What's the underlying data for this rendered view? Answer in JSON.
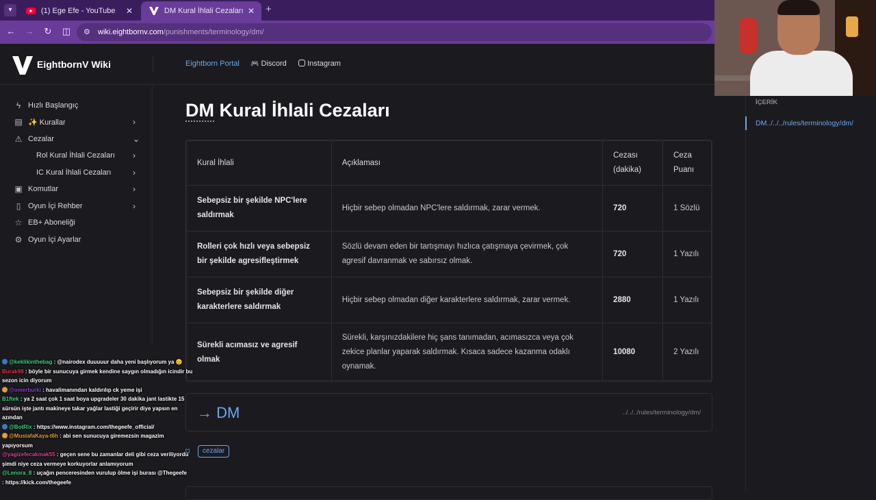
{
  "browser": {
    "tabs": [
      {
        "title": "(1) Ege Efe - YouTube",
        "favicon": "youtube-icon",
        "active": false
      },
      {
        "title": "DM Kural İhlali Cezaları",
        "favicon": "eightborn-v-icon",
        "active": true
      }
    ],
    "new_tab_label": "+",
    "url_host": "wiki.eightbornv.com",
    "url_path": "/punishments/terminology/dm/"
  },
  "header": {
    "site_title": "EightbornV Wiki",
    "links": [
      "Eightborn Portal",
      "Discord",
      "Instagram"
    ]
  },
  "sidebar": {
    "items": [
      {
        "label": "Hızlı Başlangıç",
        "icon": "bolt-icon",
        "chevron": ""
      },
      {
        "label": "✨ Kurallar",
        "icon": "book-icon",
        "chevron": "›"
      },
      {
        "label": "Cezalar",
        "icon": "warning-icon",
        "chevron": "⌄"
      },
      {
        "label": "Rol Kural İhlali Cezaları",
        "icon": "",
        "chevron": "›"
      },
      {
        "label": "IC Kural İhlali Cezaları",
        "icon": "",
        "chevron": "›"
      },
      {
        "label": "Komutlar",
        "icon": "terminal-icon",
        "chevron": "›"
      },
      {
        "label": "Oyun İçi Rehber",
        "icon": "phone-icon",
        "chevron": "›"
      },
      {
        "label": "EB+ Aboneliği",
        "icon": "star-icon",
        "chevron": ""
      },
      {
        "label": "Oyun İçi Ayarlar",
        "icon": "gear-icon",
        "chevron": ""
      }
    ]
  },
  "main": {
    "title_abbr": "DM",
    "title_rest": " Kural İhlali Cezaları",
    "table": {
      "headers": [
        "Kural İhlali",
        "Açıklaması",
        "Cezası (dakika)",
        "Ceza Puanı"
      ],
      "rows": [
        [
          "Sebepsiz bir şekilde NPC'lere saldırmak",
          "Hiçbir sebep olmadan NPC'lere saldırmak, zarar vermek.",
          "720",
          "1 Sözlü"
        ],
        [
          "Rolleri çok hızlı veya sebepsiz bir şekilde agresifleştirmek",
          "Sözlü devam eden bir tartışmayı hızlıca çatışmaya çevirmek, çok agresif davranmak ve sabırsız olmak.",
          "720",
          "1 Yazılı"
        ],
        [
          "Sebepsiz bir şekilde diğer karakterlere saldırmak",
          "Hiçbir sebep olmadan diğer karakterlere saldırmak, zarar vermek.",
          "2880",
          "1 Yazılı"
        ],
        [
          "Sürekli acımasız ve agresif olmak",
          "Sürekli, karşınızdakilere hiç şans tanımadan, acımasızca veya çok zekice planlar yaparak saldırmak. Kısaca sadece kazanma odaklı oynamak.",
          "10080",
          "2 Yazılı"
        ]
      ]
    },
    "dm_card": {
      "arrow": "→",
      "title": "DM",
      "path": "../../../rules/terminology/dm/"
    },
    "tag": "cezalar"
  },
  "toc": {
    "header": "İÇERİK",
    "items": [
      "DM../../../rules/terminology/dm/"
    ]
  },
  "chat": [
    {
      "user": "@keklikinthebag",
      "user_color": "#3fd27a",
      "msg": ": @nairodex duuuuur daha yeni başlıyorum ya 😊"
    },
    {
      "user": "Burak98",
      "user_color": "#e0344a",
      "msg": ": böyle bir sunucuya girmek kendine saygın olmadığın icindir bu sezon icin diyorum"
    },
    {
      "user": "@omerburki",
      "user_color": "#8a3fd6",
      "msg": ": havalimanından kaldırılıp ck yeme işi"
    },
    {
      "user": "B1ftek",
      "user_color": "#3fd27a",
      "msg": ": ya 2 saat çok 1 saat boya upgradeler 30 dakika jant lastikte 15 sürsün işte jantı makineye takar yağlar lastiği geçirir diye yapsın en azından"
    },
    {
      "user": "@BotRix",
      "user_color": "#3fd27a",
      "msg": ": https://www.instagram.com/thegeefe_official/"
    },
    {
      "user": "@MustafaKaya-t6h",
      "user_color": "#e0a030",
      "msg": ": abi sen sunucuya giremezsin magazim yapıyorsum"
    },
    {
      "user": "@yagizefecakmak55",
      "user_color": "#e04090",
      "msg": ": geçen sene bu zamanlar deli gibi ceza veriliyordu şimdi niye ceza vermeye korkuyorlar anlamıyorum"
    },
    {
      "user": "@Lenora_8",
      "user_color": "#3fd27a",
      "msg": ": uçağın penceresinden vurulup ölme işi burası @Thegeefe"
    },
    {
      "user": "",
      "user_color": "#ffffff",
      "msg": ": https://kick.com/thegeefe"
    }
  ],
  "colors": {
    "accent": "#6ba7ee",
    "browser_frame": "#6a3c99",
    "background": "#1b1b1f"
  }
}
